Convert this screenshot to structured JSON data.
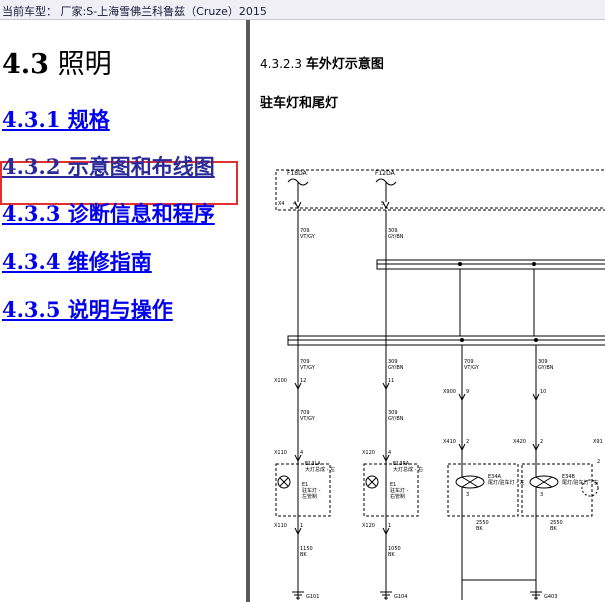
{
  "vehicle_bar": {
    "label": "当前车型：  厂家:S-上海雪佛兰科鲁兹（Cruze）2015"
  },
  "nav": {
    "chapter_number": "4.3",
    "chapter_title": "照明",
    "items": [
      {
        "label": "4.3.1 规格",
        "active": false
      },
      {
        "label": "4.3.2 示意图和布线图",
        "active": true
      },
      {
        "label": "4.3.3 诊断信息和程序",
        "active": false
      },
      {
        "label": "4.3.4 维修指南",
        "active": false
      },
      {
        "label": "4.3.5 说明与操作",
        "active": false
      }
    ],
    "highlight_color": "#e03030"
  },
  "content": {
    "section_number": "4.3.2.3",
    "section_title": "车外灯示意图",
    "subtitle": "驻车灯和尾灯"
  },
  "diagram": {
    "fuses": [
      "F18DA",
      "F12DA"
    ],
    "connectors": {
      "x4": "X4",
      "x100": "X100",
      "x110": "X110",
      "x120": "X120",
      "x900": "X900",
      "x410": "X410",
      "x420": "X420",
      "x91": "X91"
    },
    "pins": {
      "x4_a": "4",
      "x4_b": "5",
      "x100_a": "12",
      "x100_b": "11",
      "x110_a": "4",
      "x120_a": "4",
      "x900_a": "9",
      "x900_b": "10",
      "x410_a": "2",
      "x410_b": "3",
      "x420_a": "2",
      "x420_b": "3",
      "x91_a": "2",
      "x110_b": "1",
      "x120_b": "1"
    },
    "wires": [
      {
        "id": "w1",
        "num": "709",
        "color": "VT/GY"
      },
      {
        "id": "w2",
        "num": "309",
        "color": "GY/BN"
      },
      {
        "id": "w3",
        "num": "709",
        "color": "VT/GY"
      },
      {
        "id": "w4",
        "num": "309",
        "color": "GY/BN"
      },
      {
        "id": "w5",
        "num": "709",
        "color": "VT/GY"
      },
      {
        "id": "w6",
        "num": "309",
        "color": "GY/BN"
      },
      {
        "id": "w7",
        "num": "709",
        "color": "VT/GY"
      },
      {
        "id": "w8",
        "num": "309",
        "color": "GY/BN"
      },
      {
        "id": "w9",
        "num": "1150",
        "color": "BK"
      },
      {
        "id": "w10",
        "num": "1050",
        "color": "BK"
      },
      {
        "id": "w11",
        "num": "2550",
        "color": "BK"
      },
      {
        "id": "w12",
        "num": "2550",
        "color": "BK"
      }
    ],
    "lamps": [
      {
        "code": "E13LA",
        "name": "大灯总成 - 左",
        "sub": "E1\n驻车灯 -\n左管制"
      },
      {
        "code": "E13RA",
        "name": "大灯总成 - 右",
        "sub": "E1\n驻车灯 -\n右管制"
      },
      {
        "code": "E34A",
        "name": "尾灯/驻车灯 - 左",
        "sub": ""
      },
      {
        "code": "E34B",
        "name": "尾灯/驻车灯 - 右",
        "sub": ""
      }
    ],
    "grounds": [
      "G101",
      "G104",
      "G403"
    ]
  }
}
